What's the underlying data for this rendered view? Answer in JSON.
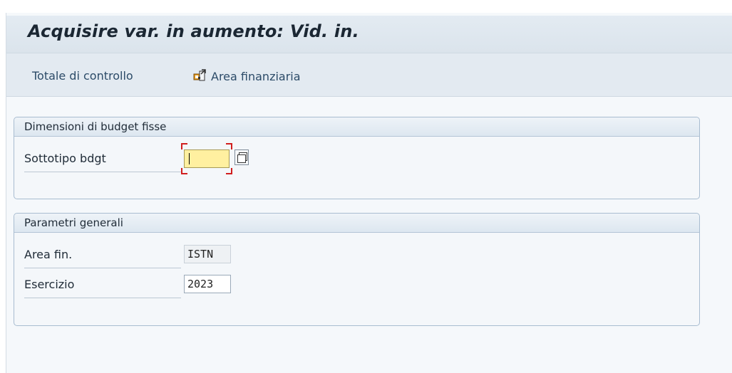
{
  "title": "Acquisire var. in aumento: Vid. in.",
  "toolbar": {
    "totale_label": "Totale di controllo",
    "area_label": "Area finanziaria",
    "area_icon": "display-change-icon"
  },
  "group_budget": {
    "title": "Dimensioni di budget fisse",
    "sottotipo_label": "Sottotipo bdgt",
    "sottotipo_value": ""
  },
  "group_params": {
    "title": "Parametri generali",
    "area_fin_label": "Area fin.",
    "area_fin_value": "ISTN",
    "esercizio_label": "Esercizio",
    "esercizio_value": "2023"
  },
  "colors": {
    "required_field_bg": "#fff0a0",
    "required_marker": "#d11e1e",
    "header_bg": "#dbe4ec"
  }
}
